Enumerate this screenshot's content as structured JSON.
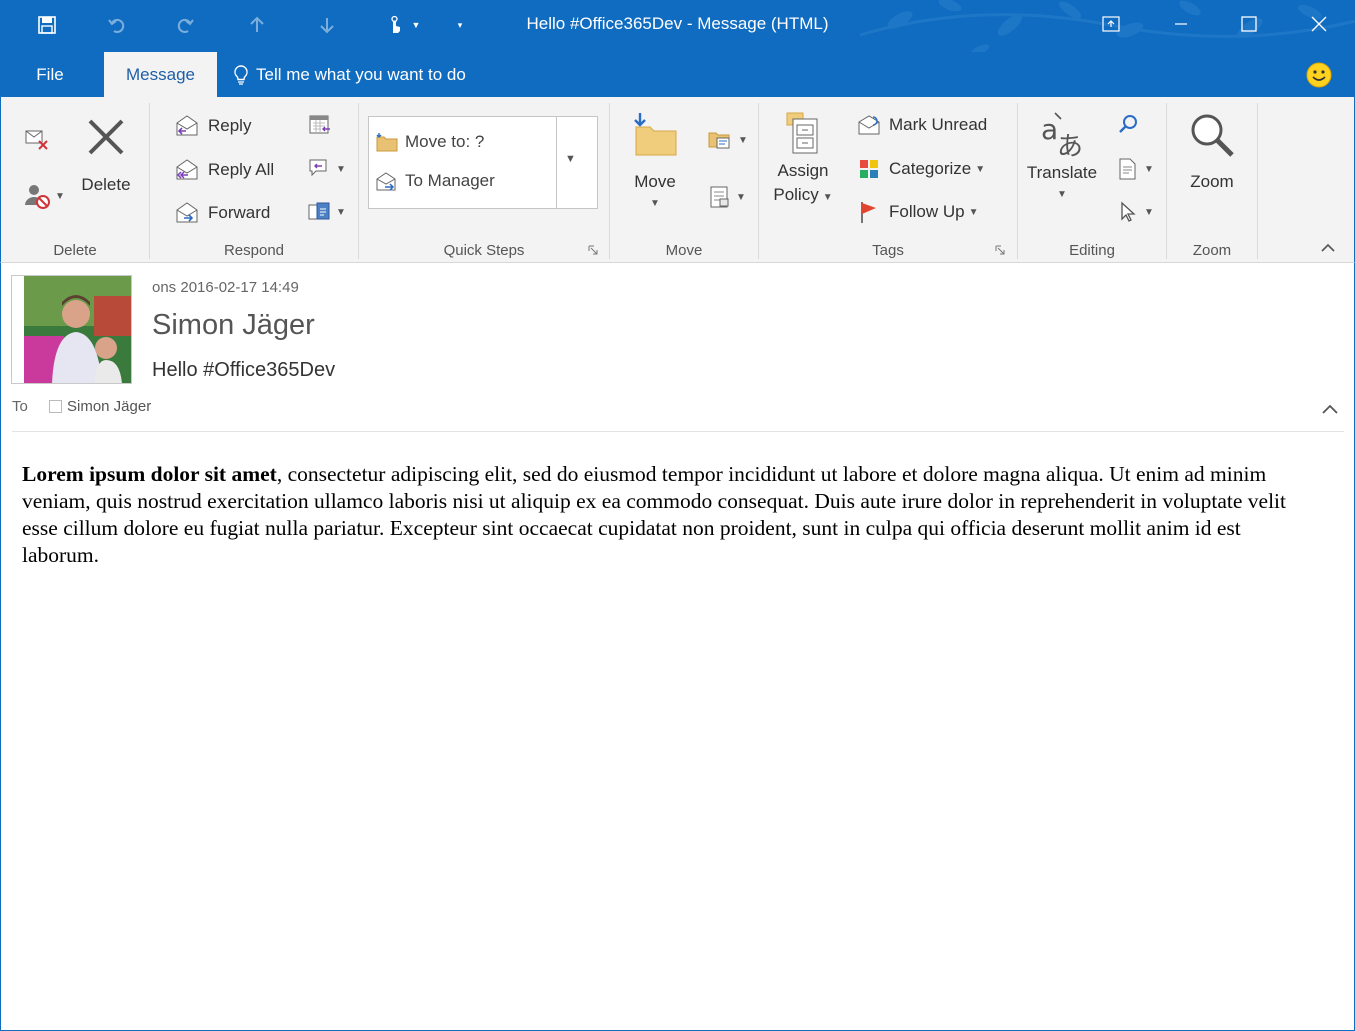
{
  "window": {
    "title": "Hello #Office365Dev - Message (HTML)"
  },
  "tabs": {
    "file": "File",
    "message": "Message",
    "tell_me": "Tell me what you want to do"
  },
  "ribbon": {
    "delete_group": {
      "label": "Delete",
      "delete_button": "Delete"
    },
    "respond_group": {
      "label": "Respond",
      "reply": "Reply",
      "reply_all": "Reply All",
      "forward": "Forward"
    },
    "quick_steps_group": {
      "label": "Quick Steps",
      "items": [
        "Move to: ?",
        "To Manager"
      ]
    },
    "move_group": {
      "label": "Move",
      "move_button": "Move"
    },
    "tags_group": {
      "label": "Tags",
      "assign_policy_line1": "Assign",
      "assign_policy_line2": "Policy",
      "mark_unread": "Mark Unread",
      "categorize": "Categorize",
      "follow_up": "Follow Up"
    },
    "editing_group": {
      "label": "Editing",
      "translate": "Translate"
    },
    "zoom_group": {
      "label": "Zoom",
      "zoom_button": "Zoom"
    }
  },
  "message": {
    "date": "ons 2016-02-17 14:49",
    "sender": "Simon Jäger",
    "subject": "Hello #Office365Dev",
    "to_label": "To",
    "to_name": "Simon Jäger",
    "body_bold": "Lorem ipsum dolor sit amet",
    "body_rest": ", consectetur adipiscing elit, sed do eiusmod tempor incididunt ut labore et dolore magna aliqua. Ut enim ad minim veniam, quis nostrud exercitation ullamco laboris nisi ut aliquip ex ea commodo consequat. Duis aute irure dolor in reprehenderit in voluptate velit esse cillum dolore eu fugiat nulla pariatur. Excepteur sint occaecat cupidatat non proident, sunt in culpa qui officia deserunt mollit anim id est laborum."
  },
  "colors": {
    "accent": "#0f6cc0",
    "ribbon_bg": "#f3f3f3"
  }
}
